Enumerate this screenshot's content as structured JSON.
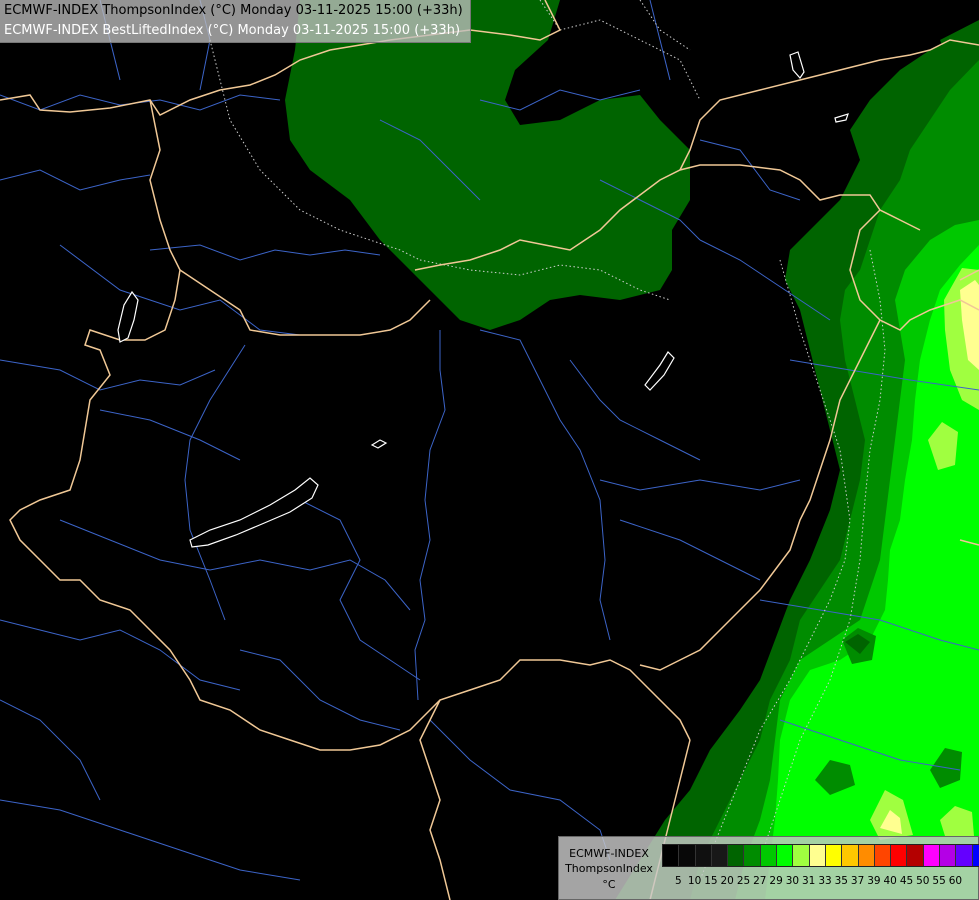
{
  "header": {
    "line1": "ECMWF-INDEX ThompsonIndex (°C) Monday 03-11-2025 15:00 (+33h)",
    "line2": "ECMWF-INDEX BestLiftedIndex (°C) Monday 03-11-2025 15:00 (+33h)"
  },
  "legend": {
    "model": "ECMWF-INDEX",
    "parameter": "ThompsonIndex",
    "unit": "°C",
    "ticks": [
      "5",
      "10",
      "15",
      "20",
      "25",
      "27",
      "29",
      "30",
      "31",
      "33",
      "35",
      "37",
      "39",
      "40",
      "45",
      "50",
      "55",
      "60"
    ],
    "colors": [
      "#000000",
      "#080808",
      "#101010",
      "#181818",
      "#006400",
      "#008c00",
      "#00c800",
      "#00ff00",
      "#a0ff40",
      "#ffff90",
      "#ffff00",
      "#ffc800",
      "#ff8c00",
      "#ff4500",
      "#ff0000",
      "#b40000",
      "#ff00ff",
      "#b400e6",
      "#6400ff",
      "#0000ff"
    ]
  },
  "map_colors": {
    "background": "#000000",
    "border": "#f0c896",
    "river": "#3c64c8",
    "lake_outline": "#ffffff",
    "index_25": "#006400",
    "index_27": "#008c00",
    "index_29": "#00c800",
    "index_30": "#00ff00",
    "index_31": "#a0ff40",
    "index_33": "#ffff90"
  }
}
